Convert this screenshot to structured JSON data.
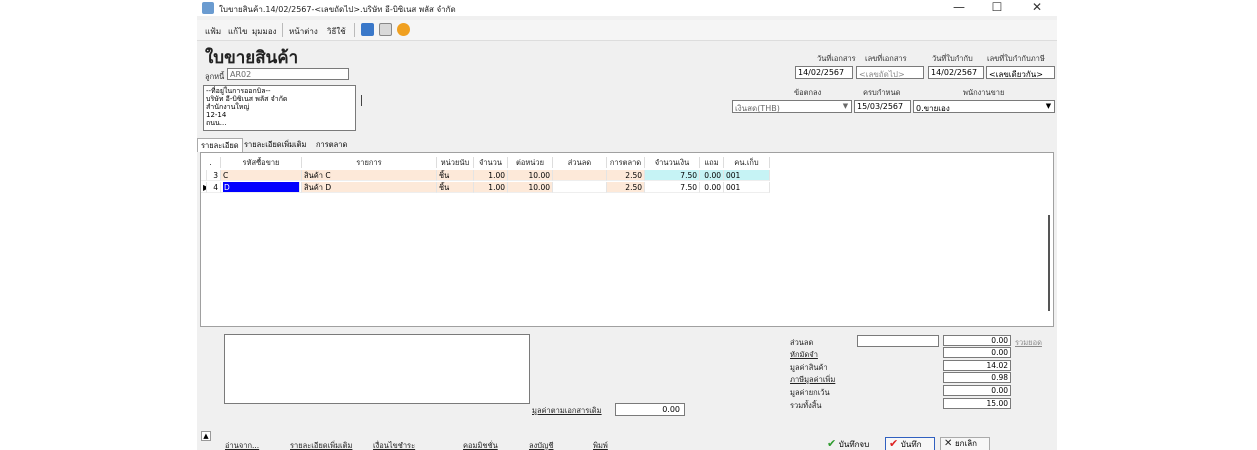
{
  "window": {
    "title": "ใบขายสินค้า.14/02/2567-<เลขถัดไป>.บริษัท อี-บิซิเนส พลัส จำกัด",
    "minimize": "—",
    "maximize": "☐",
    "close": "✕"
  },
  "menubar": {
    "items": [
      "แฟ้ม",
      "แก้ไข",
      "มุมมอง",
      "หน้าต่าง",
      "วิธีใช้"
    ]
  },
  "header": {
    "page_title": "ใบขายสินค้า",
    "customer_label": "ลูกหนี้",
    "customer_code": "AR02",
    "address_lines": [
      "--ที่อยู่ในการออกบิล--",
      "บริษัท อี-บิซิเนส พลัส จำกัด",
      "สำนักงานใหญ่",
      "12-14",
      "ถนน..."
    ],
    "doc_date_label": "วันที่เอกสาร",
    "doc_date": "14/02/2567",
    "doc_no_label": "เลขที่เอกสาร",
    "doc_no": "<เลขถัดไป>",
    "tax_date_label": "วันที่ใบกำกับ",
    "tax_date": "14/02/2567",
    "tax_no_label": "เลขที่ใบกำกับภาษี",
    "tax_no": "<เลขเดียวกัน>",
    "terms_label": "ข้อตกลง",
    "terms_value": "เงินสด(THB)",
    "due_label": "ครบกำหนด",
    "due_date": "15/03/2567",
    "salesman_label": "พนักงานขาย",
    "salesman_value": "0.ขายเอง"
  },
  "tabs": [
    "รายละเอียด",
    "รายละเอียดเพิ่มเติม",
    "การตลาด"
  ],
  "grid": {
    "columns": [
      ".",
      "รหัสซื้อขาย",
      "รายการ",
      "หน่วยนับ",
      "จำนวน",
      "ต่อหน่วย",
      "ส่วนลด",
      "การตลาด",
      "จำนวนเงิน",
      "แถม",
      "คน.เก็บ"
    ],
    "rows": [
      {
        "marker": "",
        "no": "3",
        "code": "C",
        "name": "สินค้า C",
        "unit": "ชิ้น",
        "qty": "1.00",
        "price": "10.00",
        "discount": "",
        "marketing": "2.50",
        "amount": "7.50",
        "free": "0.00",
        "wh": "001"
      },
      {
        "marker": "▶",
        "no": "4",
        "code": "D",
        "name": "สินค้า D",
        "unit": "ชิ้น",
        "qty": "1.00",
        "price": "10.00",
        "discount": "",
        "marketing": "2.50",
        "amount": "7.50",
        "free": "0.00",
        "wh": "001"
      }
    ]
  },
  "footer": {
    "ref_amount_label": "มูลค่าตามเอกสารเดิม",
    "ref_amount": "0.00",
    "discount_label": "ส่วนลด",
    "discount_value": "0.00",
    "discount_link": "รวมยอด",
    "deposit_label": "หักมัดจำ",
    "deposit_value": "0.00",
    "goods_label": "มูลค่าสินค้า",
    "goods_value": "14.02",
    "vat_label": "ภาษีมูลค่าเพิ่ม",
    "vat_value": "0.98",
    "exempt_label": "มูลค่ายกเว้น",
    "exempt_value": "0.00",
    "total_label": "รวมทั้งสิ้น",
    "total_value": "15.00",
    "links": [
      "อ่านจาก...",
      "รายละเอียดเพิ่มเติม",
      "เงื่อนไขชำระ",
      "คอมมิชชั่น",
      "ลงบัญชี",
      "พิมพ์"
    ],
    "btn_save_close": "บันทึกจบ",
    "btn_save": "บันทึก",
    "btn_cancel": "ยกเลิก"
  },
  "colors": {
    "row_highlight": "#fde9d9",
    "row_current_cell": "#c6f3f5",
    "selected_cell": "#0000ff",
    "accent_green": "#2e9b2e",
    "cancel_x": "#222222"
  }
}
